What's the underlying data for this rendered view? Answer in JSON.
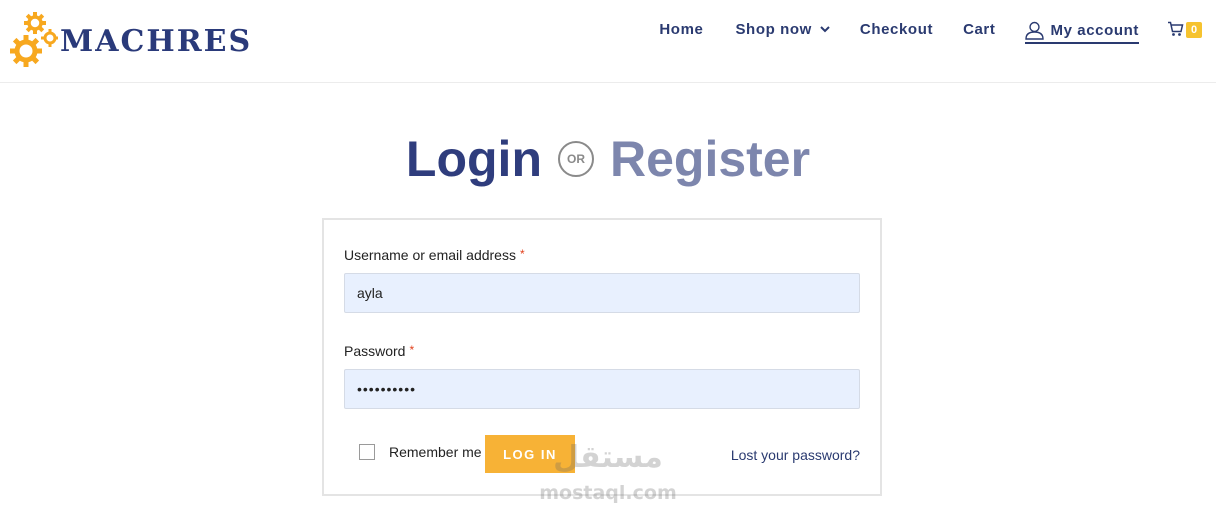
{
  "brand": {
    "name": "MACHRES",
    "logo_icon": "gears-icon"
  },
  "nav": {
    "home": "Home",
    "shop": "Shop now",
    "checkout": "Checkout",
    "cart": "Cart",
    "account": "My account",
    "cart_count": "0"
  },
  "title": {
    "login": "Login",
    "or": "OR",
    "register": "Register"
  },
  "form": {
    "username_label": "Username or email address",
    "username_value": "ayla",
    "password_label": "Password",
    "password_value": "••••••••••",
    "required_mark": "*",
    "remember_label": "Remember me",
    "login_button": "LOG IN",
    "lost_password": "Lost your password?"
  },
  "watermark": {
    "arabic": "مستقل",
    "latin": "mostaql.com"
  },
  "colors": {
    "navy": "#2a3a70",
    "accent": "#f7b236",
    "register": "#7d86ad",
    "input_bg": "#e8f0fe"
  }
}
